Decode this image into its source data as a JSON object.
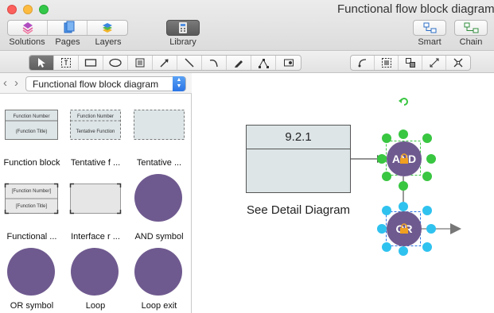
{
  "window": {
    "title": "Functional flow block diagram - E"
  },
  "toolbar": {
    "solutions_label": "Solutions",
    "pages_label": "Pages",
    "layers_label": "Layers",
    "library_label": "Library",
    "smart_label": "Smart",
    "chain_label": "Chain"
  },
  "tools": [
    "select-icon",
    "text-box-icon",
    "rectangle-icon",
    "ellipse-icon",
    "table-icon",
    "arrow-line-icon",
    "line-icon",
    "arc-icon",
    "pen-icon",
    "bezier-icon",
    "shape-insert-icon"
  ],
  "tools_right": [
    "connector-icon",
    "group-icon",
    "ungroup-icon",
    "chain-connect-icon",
    "disconnect-icon"
  ],
  "library": {
    "selected": "Functional flow block diagram",
    "items": [
      {
        "label": "Function block",
        "top": "Function Number",
        "bottom": "(Function Title)"
      },
      {
        "label": "Tentative f ...",
        "top": "Function Number",
        "bottom": "Tentative Function"
      },
      {
        "label": "Tentative  ..."
      },
      {
        "label": "Functional ...",
        "top": "[Function Number]",
        "bottom": "[Function Title]"
      },
      {
        "label": "Interface r ..."
      },
      {
        "label": "AND symbol"
      },
      {
        "label": "OR symbol"
      },
      {
        "label": "Loop"
      },
      {
        "label": "Loop exit"
      }
    ]
  },
  "canvas": {
    "function_number": "9.2.1",
    "detail_text": "See Detail Diagram",
    "and_label": "AND",
    "or_label": "OR"
  },
  "colors": {
    "symbol_purple": "#6f5a8f",
    "block_fill": "#dde5e7",
    "handle_green": "#39c641",
    "handle_blue": "#2fc2ef",
    "accent_blue": "#2a74e6"
  }
}
